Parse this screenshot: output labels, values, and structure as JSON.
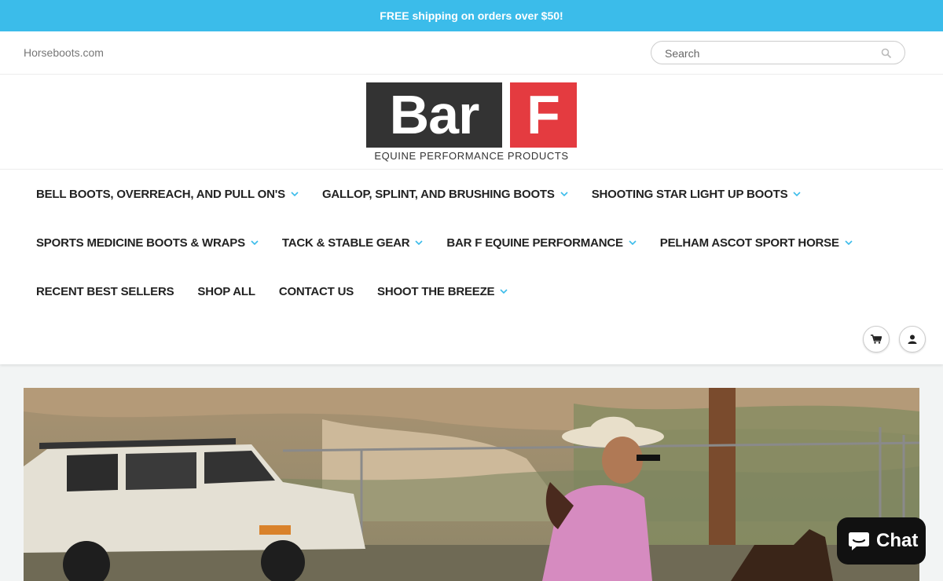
{
  "promo": {
    "text": "FREE shipping on orders over $50!"
  },
  "header": {
    "site_name": "Horseboots.com",
    "search_placeholder": "Search"
  },
  "logo": {
    "word": "Bar",
    "letter": "F",
    "tagline": "EQUINE PERFORMANCE PRODUCTS",
    "colors": {
      "dark": "#333333",
      "red": "#e43b40"
    }
  },
  "nav": {
    "row1": [
      {
        "label": "BELL BOOTS, OVERREACH, AND PULL ON'S",
        "has_dropdown": true
      },
      {
        "label": "GALLOP, SPLINT, AND BRUSHING BOOTS",
        "has_dropdown": true
      },
      {
        "label": "SHOOTING STAR LIGHT UP BOOTS",
        "has_dropdown": true
      }
    ],
    "row2": [
      {
        "label": "SPORTS MEDICINE BOOTS & WRAPS",
        "has_dropdown": true
      },
      {
        "label": "TACK & STABLE GEAR",
        "has_dropdown": true
      },
      {
        "label": "BAR F EQUINE PERFORMANCE",
        "has_dropdown": true
      },
      {
        "label": "PELHAM ASCOT SPORT HORSE",
        "has_dropdown": true
      }
    ],
    "row3": [
      {
        "label": "RECENT BEST SELLERS",
        "has_dropdown": false
      },
      {
        "label": "SHOP ALL",
        "has_dropdown": false
      },
      {
        "label": "CONTACT US",
        "has_dropdown": false
      },
      {
        "label": "SHOOT THE BREEZE",
        "has_dropdown": true
      }
    ]
  },
  "icons": {
    "cart": "cart-icon",
    "account": "user-icon",
    "search": "search-icon",
    "chat": "chat-bubble-icon"
  },
  "chat": {
    "label": "Chat"
  },
  "colors": {
    "accent": "#3bbcea",
    "promo_text": "#ffffff",
    "chat_bg": "#111111"
  }
}
